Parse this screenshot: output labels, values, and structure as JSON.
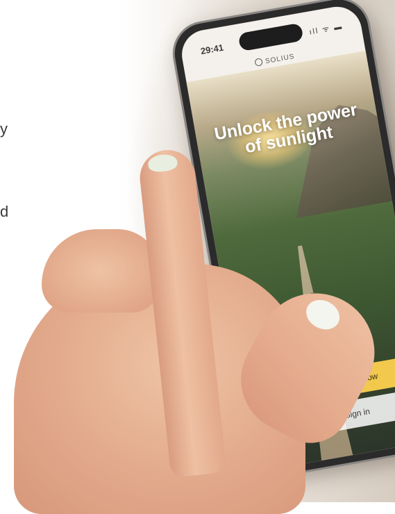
{
  "side_text": {
    "line1": "y",
    "line2": "d"
  },
  "phone": {
    "status_time": "29:41",
    "status_icons": "ıll ᯤ ▬",
    "brand_name": "SOLIUS",
    "headline_line1": "Unlock the power",
    "headline_line2": "of sunlight",
    "primary_cta_label": "Get started now",
    "secondary_cta_label": "Sign in"
  },
  "colors": {
    "cta_yellow": "#f2c94c",
    "headline_white": "#ffffff",
    "phone_frame": "#2c2b2b"
  }
}
